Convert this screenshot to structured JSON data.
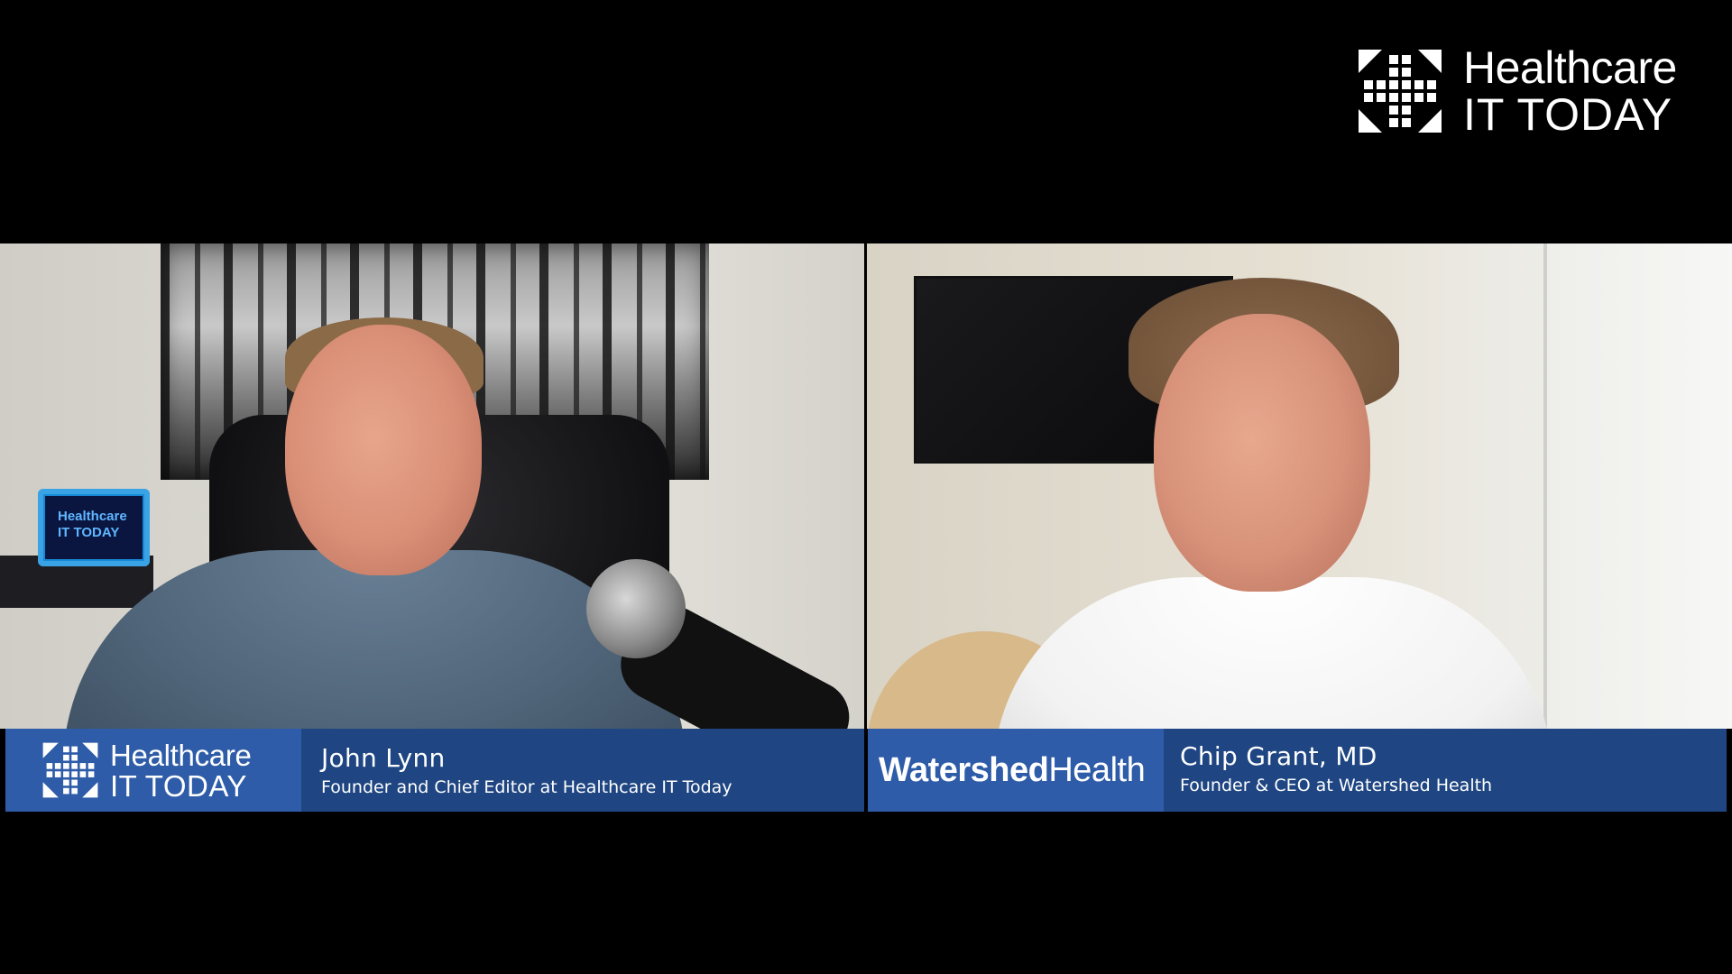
{
  "brand": {
    "line1": "Healthcare",
    "line2": "IT TODAY"
  },
  "panels": {
    "left": {
      "tablet_text": "Healthcare IT TODAY"
    }
  },
  "lower_thirds": {
    "left": {
      "logo_line1": "Healthcare",
      "logo_line2": "IT TODAY",
      "name": "John Lynn",
      "title": "Founder and Chief Editor at Healthcare IT Today"
    },
    "right": {
      "logo_bold": "Watershed",
      "logo_regular": "Health",
      "name": "Chip Grant, MD",
      "title": "Founder & CEO at Watershed Health"
    }
  },
  "colors": {
    "background": "#000000",
    "logo_blue": "#2e5ca8",
    "info_blue": "#1f4682",
    "text": "#ffffff"
  },
  "icons": {
    "brand_mark": "healthcare-it-today-logo-icon"
  }
}
